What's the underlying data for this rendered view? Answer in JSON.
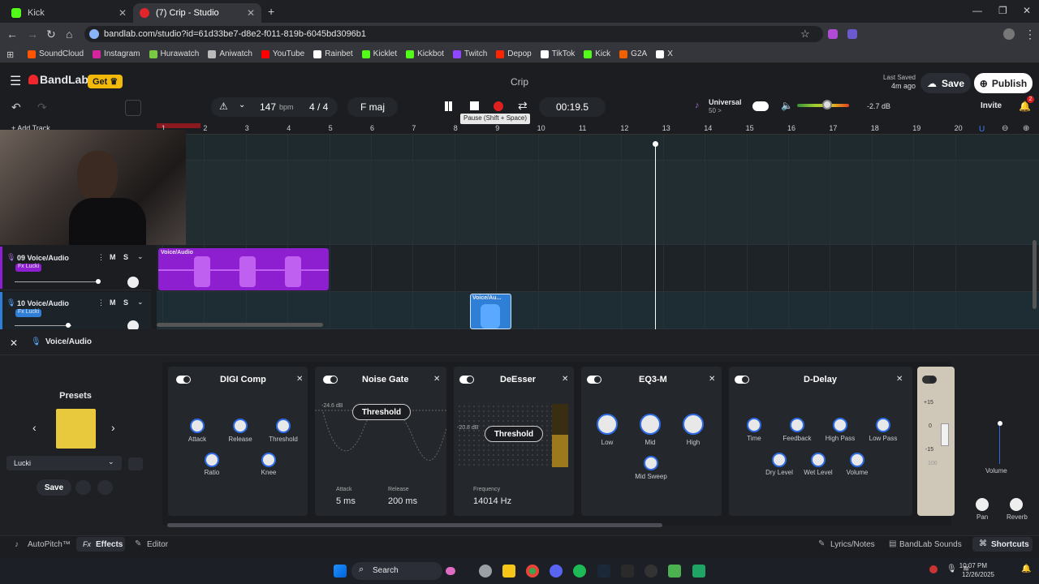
{
  "browser": {
    "tabs": [
      {
        "label": "Kick"
      },
      {
        "label": "(7) Crip - Studio"
      }
    ],
    "url": "bandlab.com/studio?id=61d33be7-d8e2-f011-819b-6045bd3096b1",
    "bookmarks": [
      {
        "label": "SoundCloud",
        "color": "#ff5500"
      },
      {
        "label": "Instagram",
        "color": "#d6249f"
      },
      {
        "label": "Hurawatch",
        "color": "#7ac943"
      },
      {
        "label": "Aniwatch",
        "color": "#bbbbbb"
      },
      {
        "label": "YouTube",
        "color": "#ff0000"
      },
      {
        "label": "Rainbet",
        "color": "#ffffff"
      },
      {
        "label": "Kicklet",
        "color": "#53fc18"
      },
      {
        "label": "Kickbot",
        "color": "#53fc18"
      },
      {
        "label": "Twitch",
        "color": "#9146ff"
      },
      {
        "label": "Depop",
        "color": "#ff2300"
      },
      {
        "label": "TikTok",
        "color": "#ffffff"
      },
      {
        "label": "Kick",
        "color": "#53fc18"
      },
      {
        "label": "G2A",
        "color": "#f05f00"
      },
      {
        "label": "X",
        "color": "#ffffff"
      }
    ]
  },
  "app": {
    "brand": "BandLab",
    "get_label": "Get",
    "project_title": "Crip",
    "last_saved_label": "Last Saved",
    "last_saved_time": "4m ago",
    "save_label": "Save",
    "publish_label": "Publish",
    "invite_label": "Invite",
    "notif_count": "2"
  },
  "toolbar": {
    "bpm_value": "147",
    "bpm_unit": "bpm",
    "time_sig": "4 / 4",
    "key": "F maj",
    "time": "00:19.5",
    "tooltip": "Pause (Shift + Space)",
    "universal_label": "Universal",
    "universal_sub": "50 >",
    "volume_db": "-2.7 dB",
    "add_track": "+ Add Track"
  },
  "ruler": [
    "1",
    "2",
    "3",
    "4",
    "5",
    "6",
    "7",
    "8",
    "9",
    "10",
    "11",
    "12",
    "13",
    "14",
    "15",
    "16",
    "17",
    "18",
    "19",
    "20"
  ],
  "tracks": [
    {
      "name": "09 Voice/Audio",
      "fx": "Fx Lucki",
      "clip": "Voice/Audio"
    },
    {
      "name": "10 Voice/Audio",
      "fx": "Fx Lucki",
      "clip": "Voice/Au..."
    }
  ],
  "panel": {
    "track_name": "Voice/Audio",
    "presets_title": "Presets",
    "preset_name": "Lucki",
    "save_label": "Save",
    "effects": [
      {
        "title": "DIGI Comp",
        "knobs": [
          "Attack",
          "Release",
          "Threshold",
          "Ratio",
          "Knee"
        ]
      },
      {
        "title": "Noise Gate",
        "threshold": "Threshold",
        "db": "-24.6 dB",
        "attack_label": "Attack",
        "attack_value": "5 ms",
        "release_label": "Release",
        "release_value": "200 ms"
      },
      {
        "title": "DeEsser",
        "threshold": "Threshold",
        "db": "-20.8 dB",
        "freq_label": "Frequency",
        "freq_value": "14014 Hz"
      },
      {
        "title": "EQ3-M",
        "knobs": [
          "Low",
          "Mid",
          "High",
          "Mid Sweep"
        ]
      },
      {
        "title": "D-Delay",
        "knobs": [
          "Time",
          "Feedback",
          "High Pass",
          "Low Pass",
          "Dry Level",
          "Wet Level",
          "Volume"
        ]
      }
    ],
    "fader_marks": [
      "+15",
      "0",
      "-15",
      "100"
    ],
    "volume_label": "Volume",
    "pan_label": "Pan",
    "reverb_label": "Reverb"
  },
  "footer": {
    "autopitch": "AutoPitch™",
    "effects": "Effects",
    "editor": "Editor",
    "lyrics": "Lyrics/Notes",
    "sounds": "BandLab Sounds",
    "shortcuts": "Shortcuts"
  },
  "taskbar": {
    "search": "Search",
    "time": "10:07 PM",
    "date": "12/26/2025"
  }
}
